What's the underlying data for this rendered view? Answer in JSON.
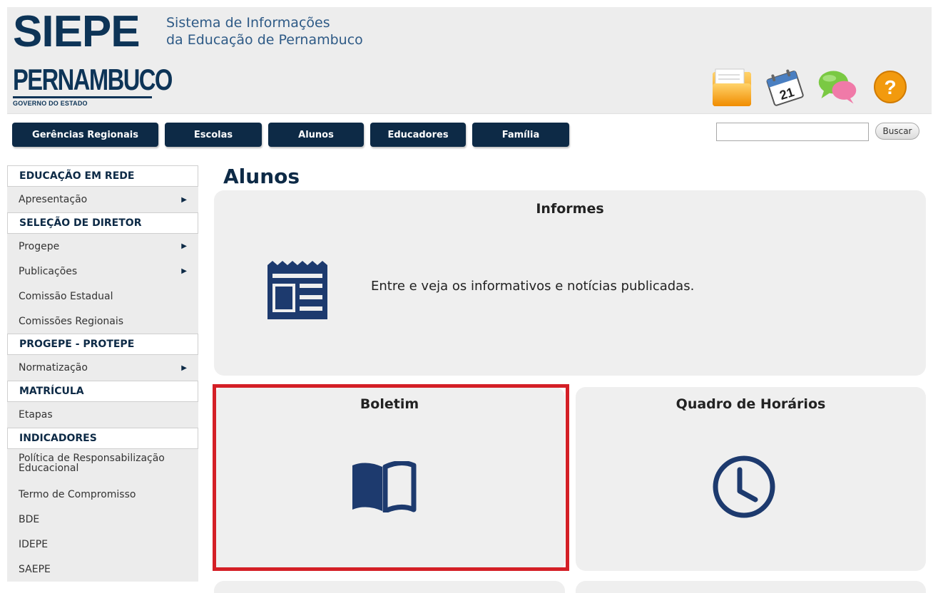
{
  "header": {
    "logo": "SIEPE",
    "subtitle_line1": "Sistema de Informações",
    "subtitle_line2": "da Educação de Pernambuco",
    "state_name": "PERNAMBUCO",
    "state_gov": "GOVERNO DO ESTADO",
    "icons": [
      "folder-icon",
      "calendar-icon",
      "chat-icon",
      "help-icon"
    ],
    "calendar_day": "21"
  },
  "nav": {
    "items": [
      "Gerências Regionais",
      "Escolas",
      "Alunos",
      "Educadores",
      "Família"
    ]
  },
  "search": {
    "button_label": "Buscar",
    "value": ""
  },
  "sidebar": {
    "sections": [
      {
        "title": "EDUCAÇÃO EM REDE",
        "items": [
          {
            "label": "Apresentação",
            "arrow": true
          }
        ]
      },
      {
        "title": "SELEÇÃO DE DIRETOR",
        "items": [
          {
            "label": "Progepe",
            "arrow": true
          },
          {
            "label": "Publicações",
            "arrow": true
          },
          {
            "label": "Comissão Estadual",
            "arrow": false
          },
          {
            "label": "Comissões Regionais",
            "arrow": false
          }
        ]
      },
      {
        "title": "PROGEPE - PROTEPE",
        "items": [
          {
            "label": "Normatização",
            "arrow": true
          }
        ]
      },
      {
        "title": "MATRÍCULA",
        "items": [
          {
            "label": "Etapas",
            "arrow": false
          }
        ]
      },
      {
        "title": "INDICADORES",
        "items": [
          {
            "label": "Política de Responsabilização Educacional",
            "arrow": false
          },
          {
            "label": "Termo de Compromisso",
            "arrow": false
          },
          {
            "label": "BDE",
            "arrow": false
          },
          {
            "label": "IDEPE",
            "arrow": false
          },
          {
            "label": "SAEPE",
            "arrow": false
          }
        ]
      }
    ]
  },
  "main": {
    "title": "Alunos",
    "cards": {
      "informes": {
        "title": "Informes",
        "text": "Entre e veja os informativos e notícias publicadas.",
        "icon": "newspaper-icon"
      },
      "boletim": {
        "title": "Boletim",
        "icon": "book-icon"
      },
      "quadro": {
        "title": "Quadro de Horários",
        "icon": "clock-icon"
      }
    },
    "accent_color": "#1d3a6e",
    "highlight_color": "#d41f26"
  }
}
